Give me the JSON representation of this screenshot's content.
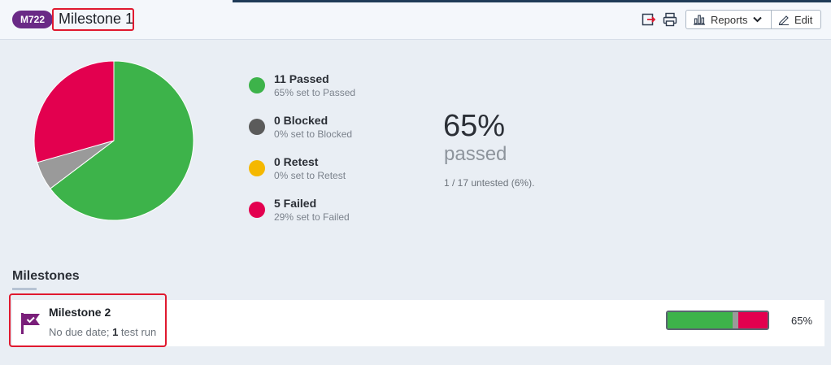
{
  "header": {
    "badge": "M722",
    "title": "Milestone 1",
    "reports_label": "Reports",
    "edit_label": "Edit"
  },
  "stats": {
    "legend": [
      {
        "main": "11 Passed",
        "sub": "65% set to Passed",
        "color": "#3db34a",
        "count": 11
      },
      {
        "main": "0 Blocked",
        "sub": "0% set to Blocked",
        "color": "#5b5b5b",
        "count": 0
      },
      {
        "main": "0 Retest",
        "sub": "0% set to Retest",
        "color": "#f5b800",
        "count": 0
      },
      {
        "main": "5 Failed",
        "sub": "29% set to Failed",
        "color": "#e3004f",
        "count": 5
      }
    ],
    "untested_color": "#9a9a9a",
    "untested_count": 1,
    "percent": "65%",
    "percent_label": "passed",
    "untested_text": "1 / 17 untested (6%)."
  },
  "milestones": {
    "section_title": "Milestones",
    "items": [
      {
        "name": "Milestone 2",
        "meta_prefix": "No due date; ",
        "meta_count": "1",
        "meta_suffix": " test run",
        "percent": "65%",
        "progress": [
          {
            "status": "passed",
            "fraction": 0.65,
            "color": "#3db34a"
          },
          {
            "status": "untested",
            "fraction": 0.06,
            "color": "#9a9a9a"
          },
          {
            "status": "failed",
            "fraction": 0.29,
            "color": "#e3004f"
          }
        ]
      }
    ]
  }
}
